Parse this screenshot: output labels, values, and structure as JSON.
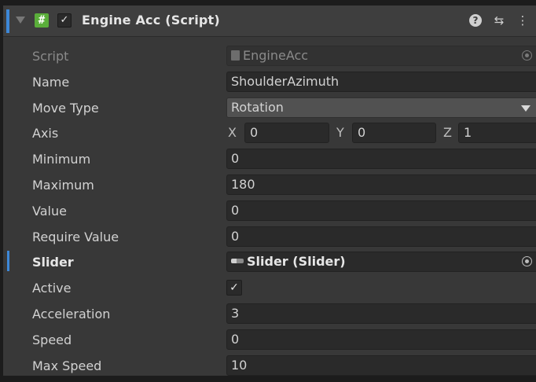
{
  "header": {
    "title": "Engine Acc (Script)",
    "enabled_check": "✓",
    "script_icon": "#",
    "icons": [
      "help-icon",
      "preset-icon",
      "kebab-menu-icon"
    ],
    "preset_glyph": "⇆",
    "kebab_glyph": "⋮",
    "help_glyph": "?"
  },
  "fields": {
    "script": {
      "label": "Script",
      "value": "EngineAcc"
    },
    "name": {
      "label": "Name",
      "value": "ShoulderAzimuth"
    },
    "move_type": {
      "label": "Move Type",
      "value": "Rotation"
    },
    "axis": {
      "label": "Axis",
      "x_label": "X",
      "x": "0",
      "y_label": "Y",
      "y": "0",
      "z_label": "Z",
      "z": "1"
    },
    "minimum": {
      "label": "Minimum",
      "value": "0"
    },
    "maximum": {
      "label": "Maximum",
      "value": "180"
    },
    "value": {
      "label": "Value",
      "value": "0"
    },
    "require_value": {
      "label": "Require Value",
      "value": "0"
    },
    "slider": {
      "label": "Slider",
      "value": "Slider (Slider)"
    },
    "active": {
      "label": "Active",
      "check": "✓"
    },
    "acceleration": {
      "label": "Acceleration",
      "value": "3"
    },
    "speed": {
      "label": "Speed",
      "value": "0"
    },
    "max_speed": {
      "label": "Max Speed",
      "value": "10"
    }
  },
  "colors": {
    "panel_bg": "#383838",
    "field_bg": "#2a2a2a",
    "accent": "#3d88d8",
    "script_icon": "#5aae3a"
  }
}
